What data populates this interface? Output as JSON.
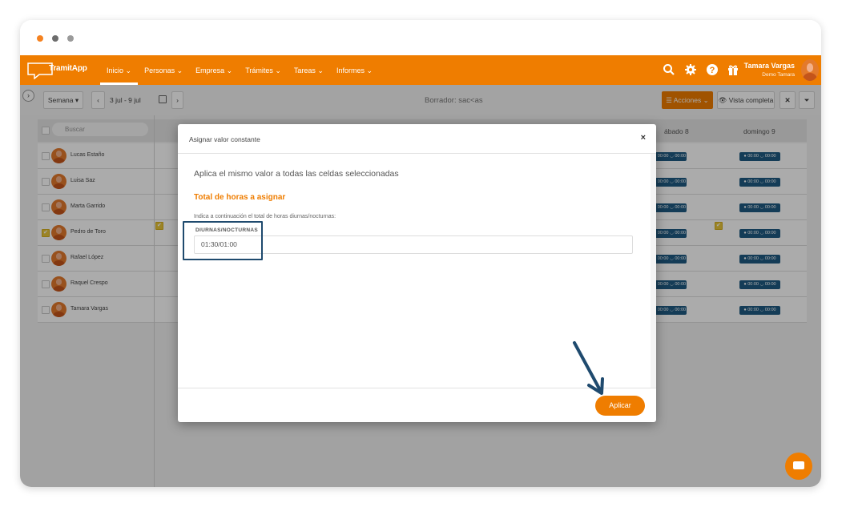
{
  "window": {
    "dots": [
      "#f58220",
      "#6d6d6d",
      "#9a9a9a"
    ]
  },
  "app": {
    "name": "TramitApp",
    "accent": "#ef7d00"
  },
  "nav": {
    "menu": [
      {
        "label": "Inicio ⌄",
        "active": true
      },
      {
        "label": "Personas ⌄",
        "active": false
      },
      {
        "label": "Empresa ⌄",
        "active": false
      },
      {
        "label": "Trámites ⌄",
        "active": false
      },
      {
        "label": "Tareas ⌄",
        "active": false
      },
      {
        "label": "Informes ⌄",
        "active": false
      }
    ],
    "icons": [
      "search-icon",
      "gear-icon",
      "help-icon",
      "gift-icon"
    ],
    "user": {
      "name": "Tamara Vargas",
      "subtitle": "Demo Tamara"
    }
  },
  "toolbar": {
    "period": "Semana ▾",
    "prev": "‹",
    "range": "3 jul - 9 jul",
    "next": "›",
    "draft": "Borrador: sac<as",
    "actions": "☰ Acciones ⌄",
    "full_view": "👁 Vista completa",
    "expand": "✕",
    "filter": "⏷"
  },
  "table": {
    "search_placeholder": "Buscar",
    "columns": [
      "ábado 8",
      "domingo 9"
    ],
    "pill": "● 00:00  ◡ 00:00",
    "rows": [
      {
        "name": "Lucas Estaño",
        "checked": false
      },
      {
        "name": "Luisa Saz",
        "checked": false
      },
      {
        "name": "Marta Garrido",
        "checked": false
      },
      {
        "name": "Pedro de Toro",
        "checked": true
      },
      {
        "name": "Rafael López",
        "checked": false
      },
      {
        "name": "Raquel Crespo",
        "checked": false
      },
      {
        "name": "Tamara Vargas",
        "checked": false
      }
    ]
  },
  "modal": {
    "title": "Asignar valor constante",
    "close": "×",
    "lead": "Aplica el mismo valor a todas las celdas seleccionadas",
    "section": "Total de horas a asignar",
    "hint": "Indica a continuación el total de horas diurnas/nocturnas:",
    "field_label": "DIURNAS/NOCTURNAS",
    "field_value": "01:30/01:00",
    "apply": "Aplicar"
  }
}
